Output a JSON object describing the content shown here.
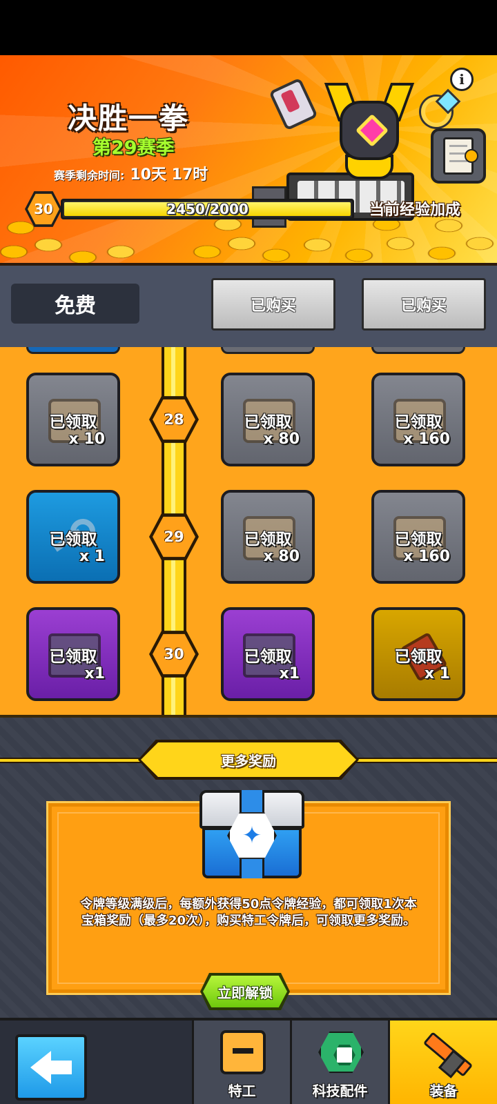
{
  "header": {
    "event_title": "决胜一拳",
    "season": "第29赛季",
    "remaining_label": "赛季剩余时间:",
    "remaining_time": "10天 17时",
    "level": "30",
    "xp_text": "2450/2000",
    "xp_progress": 1.0,
    "xp_bonus_label": "当前经验加成",
    "info_icon": "info-icon",
    "bonus_scroll_icon": "scroll-icon"
  },
  "tabs": {
    "free": "免费",
    "paid_1": "已购买",
    "paid_2": "已购买"
  },
  "rewards": {
    "rows": [
      {
        "level": "28",
        "free": {
          "status": "已领取",
          "qty": "x 10",
          "icon": "scroll-icon",
          "rarity": "gray"
        },
        "paid_1": {
          "status": "已领取",
          "qty": "x 80",
          "icon": "scroll-icon",
          "rarity": "gray"
        },
        "paid_2": {
          "status": "已领取",
          "qty": "x 160",
          "icon": "scroll-icon",
          "rarity": "gray"
        }
      },
      {
        "level": "29",
        "free": {
          "status": "已领取",
          "qty": "x 1",
          "icon": "key-icon",
          "rarity": "blue"
        },
        "paid_1": {
          "status": "已领取",
          "qty": "x 80",
          "icon": "scroll-icon",
          "rarity": "gray"
        },
        "paid_2": {
          "status": "已领取",
          "qty": "x 160",
          "icon": "scroll-icon",
          "rarity": "gray"
        }
      },
      {
        "level": "30",
        "free": {
          "status": "已领取",
          "qty": "x1",
          "icon": "chest-icon",
          "rarity": "purple"
        },
        "paid_1": {
          "status": "已领取",
          "qty": "x1",
          "icon": "chest-icon",
          "rarity": "purple"
        },
        "paid_2": {
          "status": "已领取",
          "qty": "x 1",
          "icon": "gem-icon",
          "rarity": "gold"
        }
      }
    ]
  },
  "more_rewards": {
    "title": "更多奖励",
    "description": "令牌等级满级后，每额外获得50点令牌经验，都可领取1次本宝箱奖励（最多20次），购买特工令牌后，可领取更多奖励。",
    "unlock_button": "立即解锁"
  },
  "bottom_nav": {
    "back_icon": "back-arrow-icon",
    "tabs": [
      {
        "label": "特工",
        "icon": "agent-icon"
      },
      {
        "label": "科技配件",
        "icon": "tech-parts-icon"
      },
      {
        "label": "装备",
        "icon": "equipment-icon",
        "active": true
      }
    ]
  },
  "colors": {
    "accent": "#ffa51c",
    "track": "#ffd51a",
    "unlock_green": "#6ec90d",
    "nav_active": "#ffd51a"
  }
}
